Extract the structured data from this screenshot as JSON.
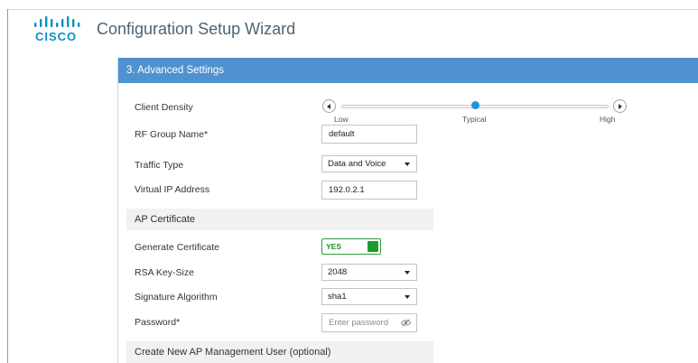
{
  "brand": {
    "logo_text": "CISCO",
    "accent": "#0b8ec6"
  },
  "app": {
    "title": "Configuration Setup Wizard"
  },
  "panel": {
    "header": "3. Advanced Settings",
    "header_color": "#4f92cf"
  },
  "client_density": {
    "label": "Client Density",
    "ticks": [
      "Low",
      "Typical",
      "High"
    ],
    "selected": "Typical",
    "selected_fraction": 0.5
  },
  "rf_group": {
    "label": "RF Group Name*",
    "value": "default"
  },
  "traffic_type": {
    "label": "Traffic Type",
    "value": "Data and Voice"
  },
  "virtual_ip": {
    "label": "Virtual IP Address",
    "value": "192.0.2.1"
  },
  "ap_certificate": {
    "section_title": "AP Certificate",
    "generate": {
      "label": "Generate Certificate",
      "toggle_text": "YES",
      "on": true
    },
    "rsa_key_size": {
      "label": "RSA Key-Size",
      "value": "2048"
    },
    "signature_algorithm": {
      "label": "Signature Algorithm",
      "value": "sha1"
    },
    "password": {
      "label": "Password*",
      "placeholder": "Enter password"
    }
  },
  "ap_user": {
    "section_title": "Create New AP Management User (optional)"
  }
}
